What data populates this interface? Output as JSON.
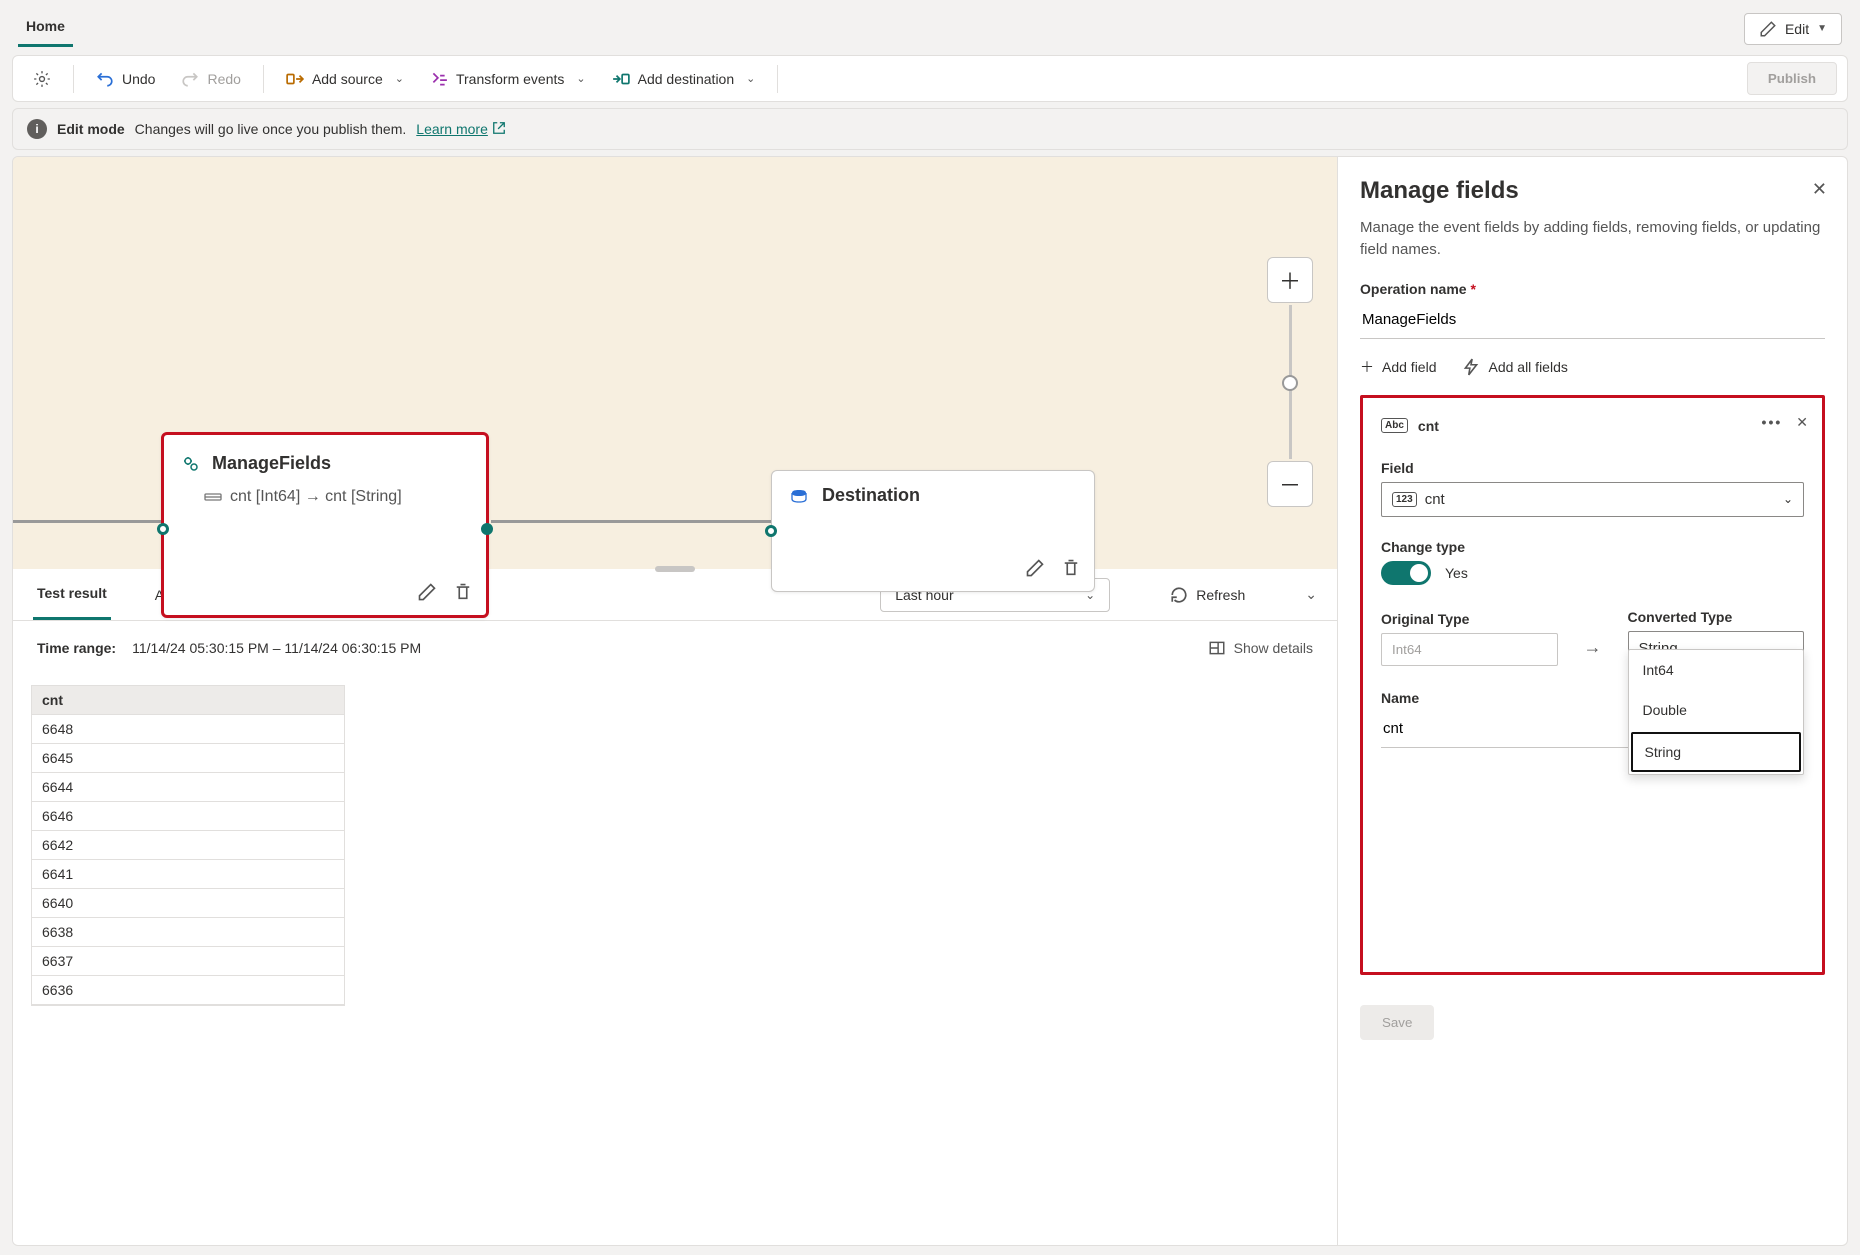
{
  "tabs": {
    "home": "Home"
  },
  "editButton": "Edit",
  "toolbar": {
    "undo": "Undo",
    "redo": "Redo",
    "addSource": "Add source",
    "transform": "Transform events",
    "addDest": "Add destination",
    "publish": "Publish"
  },
  "infobar": {
    "title": "Edit mode",
    "msg": "Changes will go live once you publish them.",
    "learn": "Learn more"
  },
  "canvas": {
    "manageFields": {
      "title": "ManageFields",
      "mapping": "cnt [Int64] → cnt [String]"
    },
    "destination": {
      "title": "Destination"
    }
  },
  "results": {
    "tabTest": "Test result",
    "tabAuth": "Authoring errors",
    "timeSel": "Last hour",
    "refresh": "Refresh",
    "timeRangeLabel": "Time range:",
    "timeRangeVal": "11/14/24 05:30:15 PM  –  11/14/24 06:30:15 PM",
    "showDetails": "Show details",
    "col": "cnt",
    "rows": [
      "6648",
      "6645",
      "6644",
      "6646",
      "6642",
      "6641",
      "6640",
      "6638",
      "6637",
      "6636"
    ]
  },
  "side": {
    "title": "Manage fields",
    "subtitle": "Manage the event fields by adding fields, removing fields, or updating field names.",
    "opNameLabel": "Operation name",
    "opName": "ManageFields",
    "addField": "Add field",
    "addAll": "Add all fields",
    "card": {
      "name": "cnt",
      "fieldLabel": "Field",
      "fieldVal": "cnt",
      "changeType": "Change type",
      "changeYes": "Yes",
      "origLabel": "Original Type",
      "origVal": "Int64",
      "convLabel": "Converted Type",
      "convVal": "String",
      "options": [
        "Int64",
        "Double",
        "String"
      ],
      "nameLabel": "Name",
      "nameVal": "cnt"
    },
    "save": "Save"
  }
}
